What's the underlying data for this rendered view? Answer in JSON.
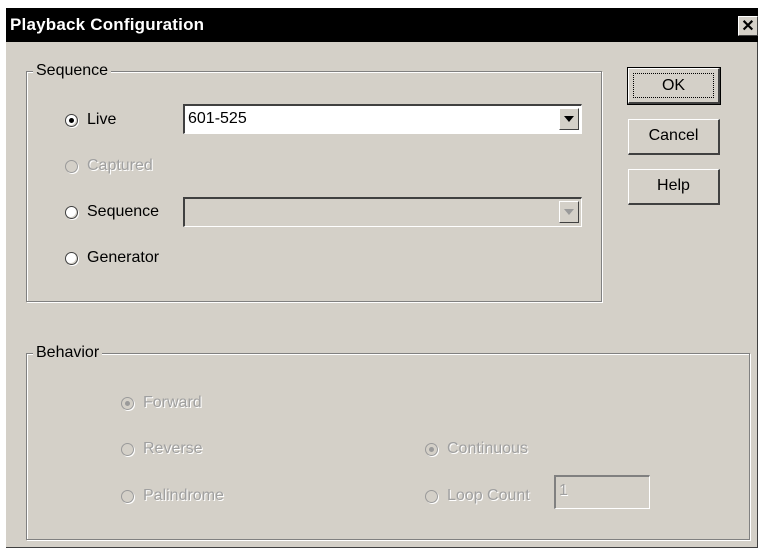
{
  "dialog": {
    "title": "Playback Configuration",
    "close_glyph": "✕"
  },
  "sequence_group": {
    "legend": "Sequence",
    "options": {
      "live": {
        "label": "Live",
        "checked": true,
        "enabled": true
      },
      "captured": {
        "label": "Captured",
        "checked": false,
        "enabled": false
      },
      "sequence": {
        "label": "Sequence",
        "checked": false,
        "enabled": true
      },
      "generator": {
        "label": "Generator",
        "checked": false,
        "enabled": true
      }
    },
    "live_select": {
      "value": "601-525",
      "enabled": true
    },
    "sequence_select": {
      "value": "",
      "enabled": false
    }
  },
  "buttons": {
    "ok": "OK",
    "cancel": "Cancel",
    "help": "Help"
  },
  "behavior_group": {
    "legend": "Behavior",
    "options": {
      "forward": {
        "label": "Forward",
        "checked": true,
        "enabled": false
      },
      "reverse": {
        "label": "Reverse",
        "checked": false,
        "enabled": false
      },
      "palindrome": {
        "label": "Palindrome",
        "checked": false,
        "enabled": false
      },
      "continuous": {
        "label": "Continuous",
        "checked": true,
        "enabled": false
      },
      "loop_count": {
        "label": "Loop Count",
        "checked": false,
        "enabled": false
      }
    },
    "loop_count_value": "1"
  },
  "icons": {
    "dropdown": "chevron-down-icon",
    "close": "close-icon"
  }
}
